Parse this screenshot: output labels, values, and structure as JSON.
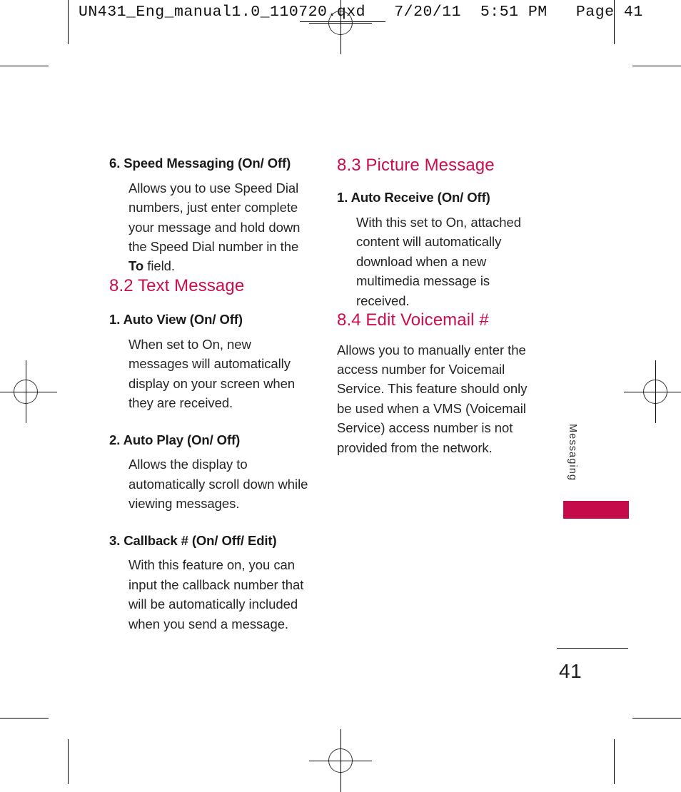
{
  "prepress": {
    "header_text": "UN431_Eng_manual1.0_110720.qxd   7/20/11  5:51 PM   Page 41"
  },
  "page": {
    "folio": "41",
    "running_head": "Messaging",
    "accent_color": "#C50B4A",
    "heading_color": "#CB0D4B"
  },
  "left_column": {
    "items": [
      {
        "title": "6. Speed Messaging (On/ Off)",
        "body_lead": "Allows you to use Speed Dial numbers, just enter complete your message and hold down the Speed Dial number in the ",
        "body_bold": "To",
        "body_tail": " field."
      }
    ],
    "heading_82": "8.2 Text Message",
    "entries": [
      {
        "title": "1. Auto View (On/ Off)",
        "body": "When set to On, new messages will automatically display on your screen when they are received."
      },
      {
        "title": "2. Auto Play (On/ Off)",
        "body": "Allows the display to automatically scroll down while viewing messages."
      },
      {
        "title": "3. Callback # (On/ Off/ Edit)",
        "body": "With this feature on, you can input the callback number that will be automatically included when you send a message."
      }
    ]
  },
  "right_column": {
    "heading_83": "8.3 Picture Message",
    "entries": [
      {
        "title": "1. Auto Receive (On/ Off)",
        "body": "With this set to On, attached content will automatically download when a new multimedia message is received."
      }
    ],
    "heading_84": "8.4 Edit Voicemail #",
    "body_84": "Allows you to manually enter the access number for Voicemail Service. This feature should only be used when a VMS (Voicemail Service) access number is not provided from the network."
  }
}
